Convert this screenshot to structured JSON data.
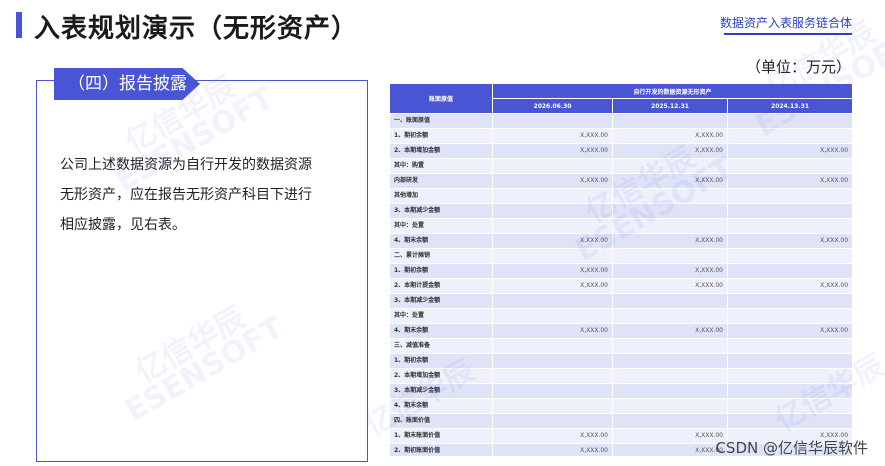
{
  "page": {
    "title": "入表规划演示（无形资产）",
    "brand": "数据资产入表服务链合体",
    "unit": "（单位：万元）"
  },
  "section": {
    "tag": "（四）报告披露",
    "paragraph_lines": [
      "公司上述数据资源为自行开发的数据资源",
      "无形资产，应在报告无形资产科目下进行",
      "相应披露，见右表。"
    ]
  },
  "table": {
    "header_left": "账面原值",
    "header_group": "自行开发的数据资源无形资产",
    "columns": [
      "2026.06.30",
      "2025.12.31",
      "2024.13.31"
    ],
    "rows": [
      {
        "label": "一、账面原值",
        "values": [
          "",
          "",
          ""
        ]
      },
      {
        "label": "1、期初余额",
        "values": [
          "X,XXX.00",
          "X,XXX.00",
          ""
        ]
      },
      {
        "label": "2、本期增加金额",
        "values": [
          "X,XXX.00",
          "X,XXX.00",
          "X,XXX.00"
        ]
      },
      {
        "label": "其中：购置",
        "values": [
          "",
          "",
          ""
        ]
      },
      {
        "label": "内部研发",
        "values": [
          "X,XXX.00",
          "X,XXX.00",
          "X,XXX.00"
        ]
      },
      {
        "label": "其他增加",
        "values": [
          "",
          "",
          ""
        ]
      },
      {
        "label": "3、本期减少金额",
        "values": [
          "",
          "",
          ""
        ]
      },
      {
        "label": "其中：处置",
        "values": [
          "",
          "",
          ""
        ]
      },
      {
        "label": "4、期末余额",
        "values": [
          "X,XXX.00",
          "X,XXX.00",
          "X,XXX.00"
        ]
      },
      {
        "label": "二、累计摊销",
        "values": [
          "",
          "",
          ""
        ]
      },
      {
        "label": "1、期初余额",
        "values": [
          "X,XXX.00",
          "X,XXX.00",
          ""
        ]
      },
      {
        "label": "2、本期计提金额",
        "values": [
          "X,XXX.00",
          "X,XXX.00",
          "X,XXX.00"
        ]
      },
      {
        "label": "3、本期减少金额",
        "values": [
          "",
          "",
          ""
        ]
      },
      {
        "label": "其中：处置",
        "values": [
          "",
          "",
          ""
        ]
      },
      {
        "label": "4、期末余额",
        "values": [
          "X,XXX.00",
          "X,XXX.00",
          "X,XXX.00"
        ]
      },
      {
        "label": "三、减值准备",
        "values": [
          "",
          "",
          ""
        ]
      },
      {
        "label": "1、期初余额",
        "values": [
          "",
          "",
          ""
        ]
      },
      {
        "label": "2、本期增加金额",
        "values": [
          "",
          "",
          ""
        ]
      },
      {
        "label": "3、本期减少金额",
        "values": [
          "",
          "",
          ""
        ]
      },
      {
        "label": "4、期末余额",
        "values": [
          "",
          "",
          ""
        ]
      },
      {
        "label": "四、账面价值",
        "values": [
          "",
          "",
          ""
        ]
      },
      {
        "label": "1、期末账面价值",
        "values": [
          "X,XXX.00",
          "X,XXX.00",
          "X,XXX.00"
        ]
      },
      {
        "label": "2、期初账面价值",
        "values": [
          "X,XXX.00",
          "X,XXX.00",
          ""
        ]
      }
    ]
  },
  "watermark": {
    "line1": "亿信华辰",
    "line2": "ESENSOFT"
  },
  "footer": {
    "csdn": "CSDN @亿信华辰软件"
  },
  "colors": {
    "accent": "#4a55d6",
    "row_a": "#dfe3f8",
    "row_b": "#eef0fb"
  }
}
